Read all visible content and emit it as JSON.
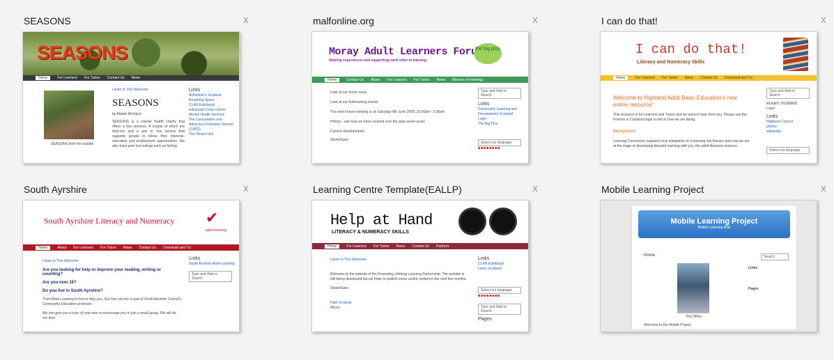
{
  "tiles": [
    {
      "title": "SEASONS",
      "close": "x"
    },
    {
      "title": "malfonline.org",
      "close": "x"
    },
    {
      "title": "I can do that!",
      "close": "x"
    },
    {
      "title": "South Ayrshire",
      "close": "x"
    },
    {
      "title": "Learning Centre Template(EALLP)",
      "close": "x"
    },
    {
      "title": "Mobile Learning Project",
      "close": "x"
    }
  ],
  "seasons": {
    "logo": "SEASONS",
    "heading": "SEASONS",
    "byline": "by Alistair McIntyre",
    "listen": "Listen to This Welcome",
    "body": "SEASONS is a mental health charity that offers a few services. A couple of which are drop-ins and a one to one service that supports people to follow their interests, education and employment opportunities. We also have peer led outings such as fishing.",
    "caption": "SEASONS from the outside",
    "links_title": "Links",
    "links": [
      "Alzheimer's Scotland",
      "Breathing Space",
      "CLAN Edinburgh",
      "Edinburgh Crisis Centre",
      "Mental Health Services",
      "The Consultation and",
      "Advocacy Promotion Service",
      "(CAPS)",
      "The Tenant Unit"
    ],
    "nav": [
      "Home",
      "For Learners",
      "For Tutors",
      "Contact Us",
      "News"
    ]
  },
  "moray": {
    "title": "Moray Adult Learners Forum",
    "tagline": "Sharing experiences and supporting each other in learning",
    "badge": "the big plus",
    "nav": [
      "Home",
      "Contact Us",
      "About",
      "For Learners",
      "For Tutors",
      "News",
      "Minutes of meetings"
    ],
    "lines": [
      "Look at our forum news",
      "Look at our forthcoming events",
      "The next Forum meeting is on Saturday 8th June 2009, 10.00am - 2.30pm",
      "History - see how we have evolved over the past seven years",
      "Current developments"
    ],
    "share": "Share/Save",
    "search": "Type and Wait to Search",
    "links_title": "Links",
    "links": [
      "Community Learning and Development Scotland",
      "Login",
      "The Big Plus"
    ],
    "translate": "Select our language"
  },
  "icando": {
    "title": "I can do that!",
    "subtitle": "Literacy and Numeracy Skills",
    "nav": [
      "Home",
      "For Learners",
      "For Tutors",
      "News",
      "Contact Us",
      "Download and Try"
    ],
    "welcome": "Welcome to Highland Adult Basic Education's new online resource!",
    "p1": "This resource is for Learners and Tutors and we want to hear from you. Please use the Forums or Contacts page to tell us how we are doing.",
    "background": "Background",
    "p2": "Learning Connection supports local integration of e-learning into literacy and now we are at the stage of developing blended learning with you, the adult literacies learners.",
    "search": "Type and Wait to Search",
    "side1": "eLearn Scotland",
    "side1b": "Login",
    "links_title": "Links",
    "links": [
      "Highland Council",
      "photos",
      "wikipedia"
    ],
    "translate": "Select our language"
  },
  "ayrshire": {
    "title": "South Ayrshire Literacy and Numeracy",
    "logo_text": "adult learning",
    "nav": [
      "Home",
      "About",
      "For Learners",
      "For Tutors",
      "News",
      "Contact Us",
      "Download and Try"
    ],
    "listen": "Listen to This Welcome",
    "q1": "Are you looking for help to improve your reading, writing or counting?",
    "q2": "Are you over 16?",
    "q3": "Do you live in South Ayrshire?",
    "p1": "Then Adult Learning is free to help you. Our free service is part of South Ayrshire Council's Community Education provision.",
    "p2": "We can give you a tutor of your own or encourage you to join a small group. We will do our best",
    "links_title": "Links",
    "links": [
      "South Ayrshire Adult Learning"
    ],
    "search": "Type and Wait to Search"
  },
  "helpathand": {
    "title": "Help at Hand",
    "subtitle": "LITERACY & NUMERACY SKILLS",
    "nav": [
      "Home",
      "For Learners",
      "For Tutors",
      "News",
      "Contact Us",
      "Partners"
    ],
    "listen": "Listen to This Welcome",
    "p1": "Welcome to the website of the Promoting Lifelong Learning Partnership. The website is still being developed but we hope to publish some useful content in the next few months.",
    "share": "Share/Save",
    "links_title": "Links",
    "links": [
      "CLAN Edinburgh",
      "Learn Scotland"
    ],
    "translate": "Select our language",
    "search": "Type and Wait to Search",
    "pages": "Pages",
    "bottom_links": [
      "High Contrast",
      "About"
    ]
  },
  "mobile": {
    "header": "Mobile Learning Project",
    "header_sub": "Mobile Learning Wiki",
    "home": "Home",
    "caption": "The Office",
    "footer": "Welcome to the Mobile Project",
    "search": "Search",
    "side_links": [
      "Links",
      "Pages"
    ]
  }
}
